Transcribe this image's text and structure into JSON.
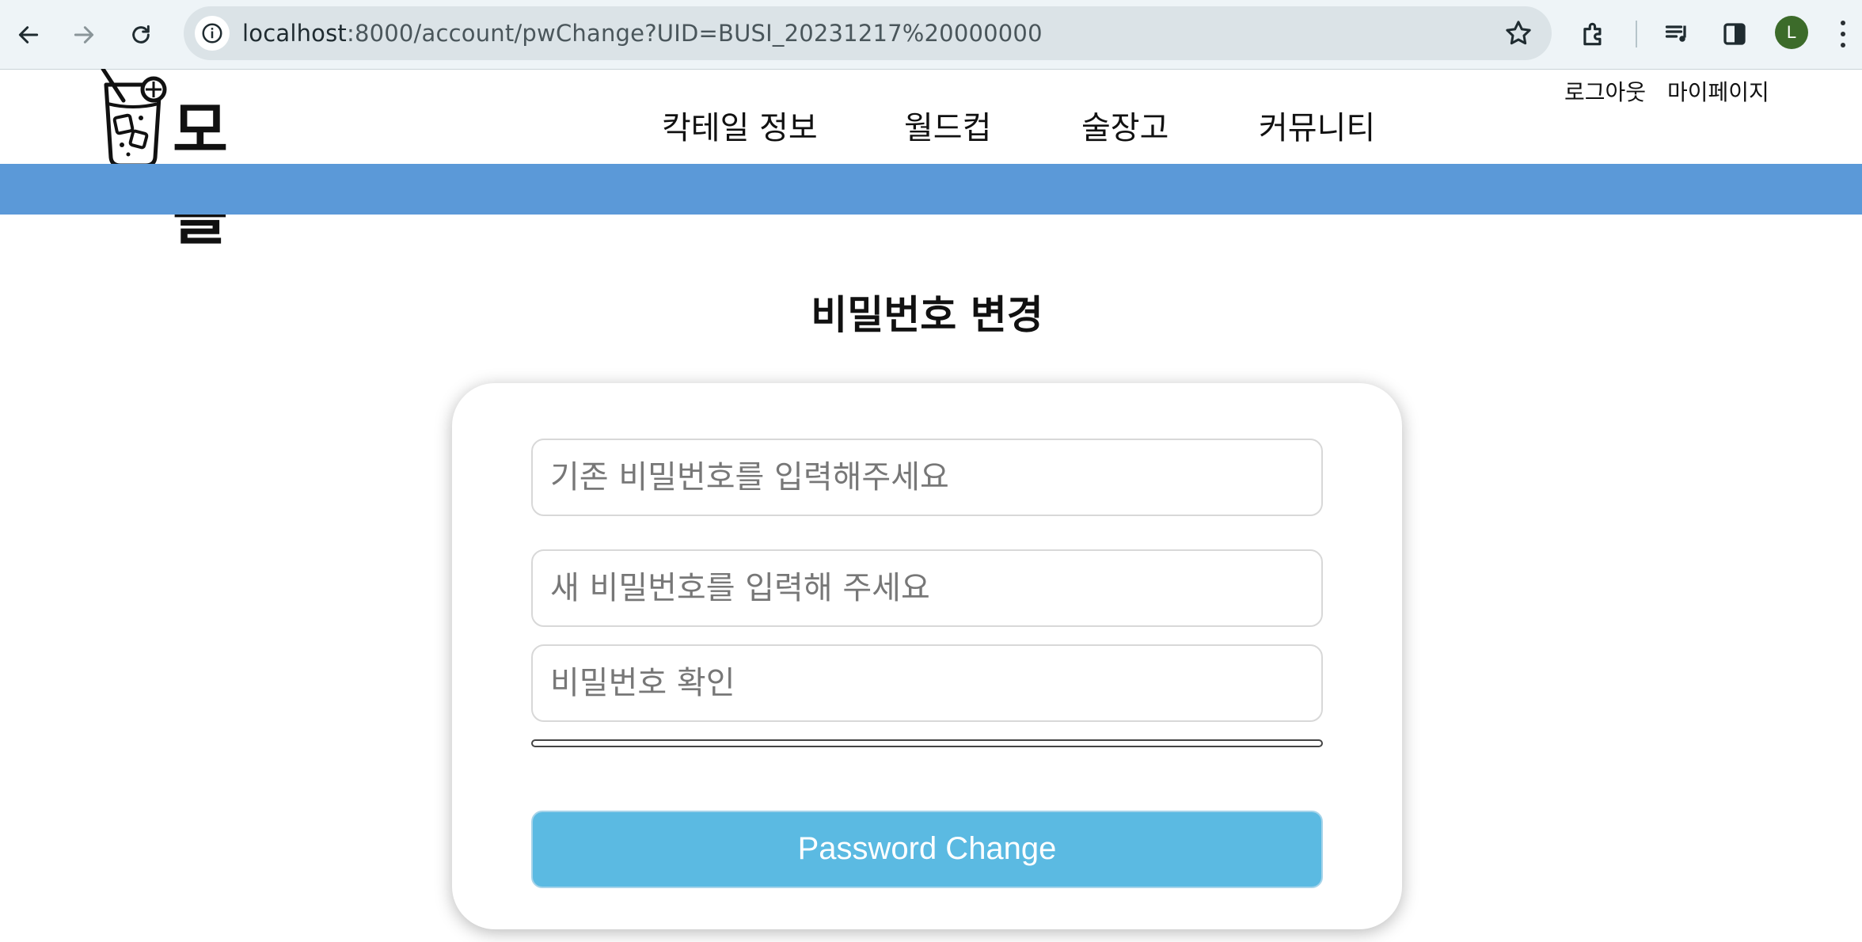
{
  "browser": {
    "url_host": "localhost",
    "url_path": ":8000/account/pwChange?UID=BUSI_20231217%20000000",
    "profile_initial": "L",
    "icons": [
      "back-arrow-icon",
      "forward-arrow-icon",
      "reload-icon",
      "site-info-icon",
      "bookmark-star-icon",
      "extensions-icon",
      "media-queue-icon",
      "side-panel-icon",
      "more-menu-icon"
    ]
  },
  "site": {
    "logo_text": "모몰",
    "nav": [
      "칵테일 정보",
      "월드컵",
      "술장고",
      "커뮤니티"
    ],
    "logout": "로그아웃",
    "mypage": "마이페이지",
    "band_color": "#5b99d8"
  },
  "form": {
    "title": "비밀번호 변경",
    "current_pw_placeholder": "기존 비밀번호를 입력해주세요",
    "new_pw_placeholder": "새 비밀번호를 입력해 주세요",
    "confirm_pw_placeholder": "비밀번호 확인",
    "submit_label": "Password Change",
    "submit_color": "#5bbae2"
  }
}
